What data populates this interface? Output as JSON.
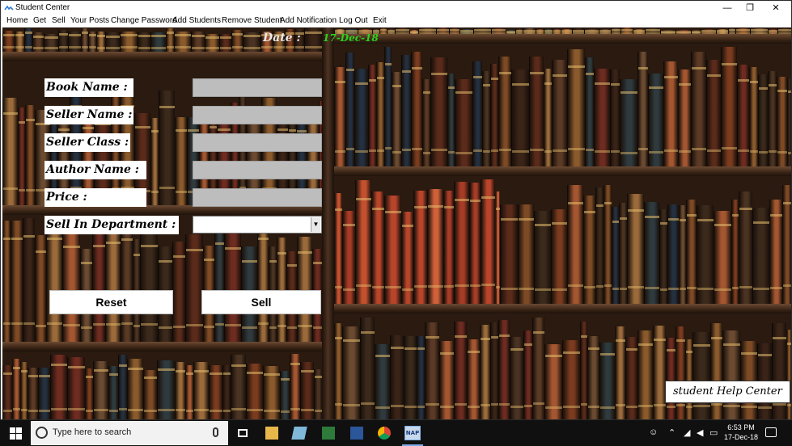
{
  "window": {
    "title": "Student Center",
    "minimize_glyph": "—",
    "restore_glyph": "❐",
    "close_glyph": "✕"
  },
  "menu": [
    "Home",
    "Get",
    "Sell",
    "Your Posts",
    "Change Password",
    "Add Students",
    "Remove Student",
    "Add Notification",
    "Log Out",
    "Exit"
  ],
  "date": {
    "label": "Date :",
    "value": "17-Dec-18"
  },
  "form": {
    "book_name_label": "Book Name :",
    "seller_name_label": "Seller Name :",
    "seller_class_label": "Seller Class :",
    "author_name_label": "Author Name :",
    "price_label": "Price :",
    "department_label": "Sell In Department :",
    "book_name_value": "",
    "seller_name_value": "",
    "seller_class_value": "",
    "author_name_value": "",
    "price_value": "",
    "department_value": ""
  },
  "buttons": {
    "reset": "Reset",
    "sell": "Sell"
  },
  "help": {
    "label": "student Help Center"
  },
  "taskbar": {
    "search_placeholder": "Type here to search",
    "nap_label": "NAP",
    "time": "6:53 PM",
    "date": "17-Dec-18",
    "tray_icons": [
      "people-icon",
      "chevron-up-icon",
      "network-icon",
      "speaker-icon",
      "battery-icon"
    ]
  },
  "colors": {
    "date_value": "#2bd21c",
    "input_fill": "#bdbdbd",
    "taskbar": "#101010"
  }
}
